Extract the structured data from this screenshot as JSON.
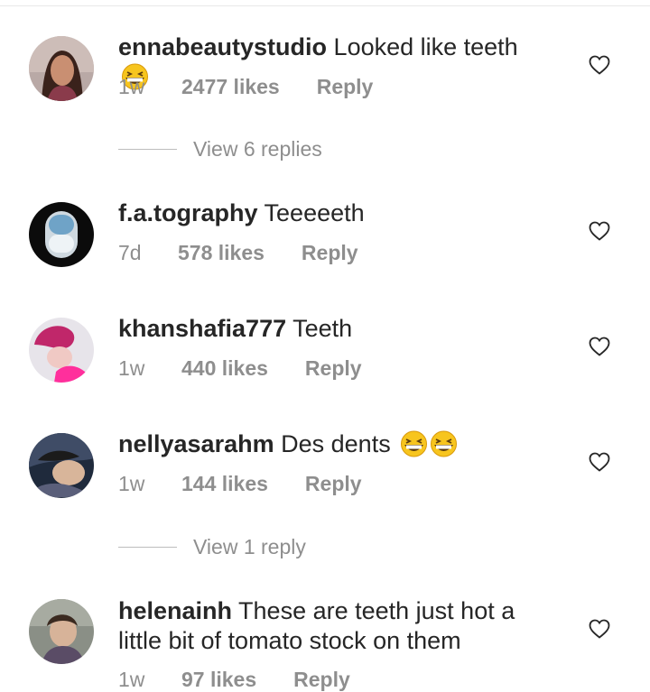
{
  "comments": [
    {
      "username": "ennabeautystudio",
      "text": "Looked like teeth",
      "time": "1w",
      "likes": "2477 likes",
      "reply": "Reply",
      "emoji_count": 1
    },
    {
      "username": "f.a.tography",
      "text": "Teeeeeth",
      "time": "7d",
      "likes": "578 likes",
      "reply": "Reply",
      "emoji_count": 0
    },
    {
      "username": "khanshafia777",
      "text": "Teeth",
      "time": "1w",
      "likes": "440 likes",
      "reply": "Reply",
      "emoji_count": 0
    },
    {
      "username": "nellyasarahm",
      "text": "Des dents",
      "time": "1w",
      "likes": "144 likes",
      "reply": "Reply",
      "emoji_count": 2
    },
    {
      "username": "helenainh",
      "text": "These are teeth just hot  a little bit of tomato stock on them",
      "time": "1w",
      "likes": "97 likes",
      "reply": "Reply",
      "emoji_count": 0
    }
  ],
  "view_replies": [
    "View 6 replies",
    "View 1 reply"
  ],
  "icons": {
    "heart": "heart-outline-icon",
    "emoji": "grinning-squinting-face-emoji"
  },
  "colors": {
    "text": "#262626",
    "meta": "#8e8e8e",
    "emoji": "#f7c51e"
  }
}
